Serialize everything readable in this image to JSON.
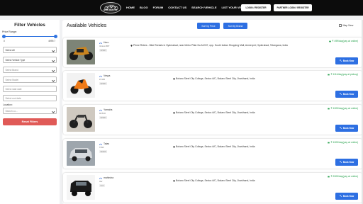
{
  "nav": {
    "logo_text": "BIKE RENTAL",
    "links": [
      "HOME",
      "BLOG",
      "FORUM",
      "CONTACT US",
      "SEARCH VEHICLE",
      "LIST YOUR VEHICLE"
    ],
    "login_register": "LOGIN / REGISTER",
    "partner_login": "PARTNER LOGIN / REGISTER"
  },
  "filters": {
    "title": "Filter Vehicles",
    "price_label": "Price Range:",
    "price_min": "0",
    "price_max": "4999.7",
    "city": "Select All",
    "vehicle_type": "Select Vehicle Type",
    "brand": "Select Brand",
    "model": "Select Model",
    "start_date_placeholder": "Select start date",
    "end_date_placeholder": "Select end date",
    "location_label": "Location:",
    "location_value": "Search Lo...",
    "reset_label": "Reset Filters"
  },
  "main": {
    "title": "Available Vehicles",
    "sort_price": "Sort by Price",
    "sort_brand": "Sort by Brand",
    "map_view": "Map View"
  },
  "vehicles": [
    {
      "name": "Hero",
      "plate": "Various BRT",
      "badge": "SPORT",
      "location": "Prime Riders - Bike Rentals in Hyderabad, near Metro Pillar No A1037, opp. South Indian Shopping Mall, Ameerpet, Hyderabad, Telangana, India",
      "price": "₹ 499/day(pay at online)",
      "book_label": "Book Now"
    },
    {
      "name": "Vespa",
      "plate": "ZX10R",
      "badge": "SPORT",
      "location": "Bokaro Steel City College, Sector-6/C, Bokaro Steel City, Jharkhand, India",
      "price": "₹ 1111/day(pay at pickup)",
      "book_label": "Book Now"
    },
    {
      "name": "Yamaha",
      "plate": "MX5XR",
      "badge": "SPORT",
      "location": "Bokaro Steel City College, Sector-6/C, Bokaro Steel City, Jharkhand, India",
      "price": "₹ 1000/day(pay at online)",
      "book_label": "Book Now"
    },
    {
      "name": "Tatas",
      "plate": "TN90",
      "badge": "SEDAN",
      "location": "Bokaro Steel City College, Sector-6/C, Bokaro Steel City, Jharkhand, India",
      "price": "₹ 1000/day(pay at online)",
      "book_label": "Book Now"
    },
    {
      "name": "mahindra",
      "plate": "thar",
      "badge": "SUV",
      "location": "Bokaro Steel City College, Sector-6/C, Bokaro Steel City, Jharkhand, India",
      "price": "₹ 2000/day(pay at online)",
      "book_label": "Book Now"
    }
  ],
  "colors": {
    "accent": "#2d6fe2",
    "reset": "#e05a57",
    "price_green": "#23a04a",
    "nav_bg": "#0c0c0c"
  },
  "icons": [
    "motorcycle-icon",
    "map-pin-icon",
    "wallet-icon",
    "key-icon"
  ]
}
